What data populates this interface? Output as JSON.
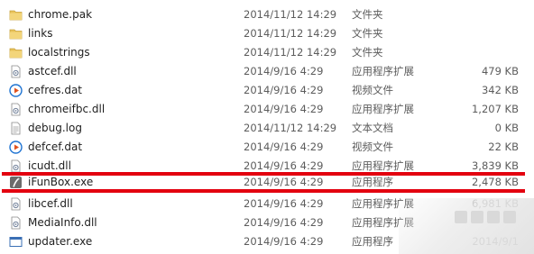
{
  "rows": [
    {
      "name": "chrome.pak",
      "date": "2014/11/12 14:29",
      "type": "文件夹",
      "size": "",
      "icon": "folder-icon"
    },
    {
      "name": "links",
      "date": "2014/11/12 14:29",
      "type": "文件夹",
      "size": "",
      "icon": "folder-icon"
    },
    {
      "name": "localstrings",
      "date": "2014/11/12 14:29",
      "type": "文件夹",
      "size": "",
      "icon": "folder-icon"
    },
    {
      "name": "astcef.dll",
      "date": "2014/9/16 4:29",
      "type": "应用程序扩展",
      "size": "479 KB",
      "icon": "dll-icon"
    },
    {
      "name": "cefres.dat",
      "date": "2014/9/16 4:29",
      "type": "视频文件",
      "size": "342 KB",
      "icon": "media-icon"
    },
    {
      "name": "chromeifbc.dll",
      "date": "2014/9/16 4:29",
      "type": "应用程序扩展",
      "size": "1,207 KB",
      "icon": "dll-icon"
    },
    {
      "name": "debug.log",
      "date": "2014/11/12 14:29",
      "type": "文本文档",
      "size": "0 KB",
      "icon": "text-file-icon"
    },
    {
      "name": "defcef.dat",
      "date": "2014/9/16 4:29",
      "type": "视频文件",
      "size": "22 KB",
      "icon": "media-icon"
    },
    {
      "name": "icudt.dll",
      "date": "2014/9/16 4:29",
      "type": "应用程序扩展",
      "size": "3,839 KB",
      "icon": "dll-icon"
    },
    {
      "name": "iFunBox.exe",
      "date": "2014/9/16 4:29",
      "type": "应用程序",
      "size": "2,478 KB",
      "icon": "ifunbox-app-icon"
    },
    {
      "name": "libcef.dll",
      "date": "2014/9/16 4:29",
      "type": "应用程序扩展",
      "size": "6,981 KB",
      "icon": "dll-icon"
    },
    {
      "name": "MediaInfo.dll",
      "date": "2014/9/16 4:29",
      "type": "应用程序扩展",
      "size": "",
      "icon": "dll-icon"
    },
    {
      "name": "updater.exe",
      "date": "2014/9/16 4:29",
      "type": "应用程序",
      "size": "2014/9/1",
      "icon": "exe-window-icon"
    }
  ],
  "highlighted_row": "iFunBox.exe",
  "colors": {
    "highlight_border": "#e3000f",
    "folder": "#e8c25a",
    "media": "#1e73d2"
  }
}
